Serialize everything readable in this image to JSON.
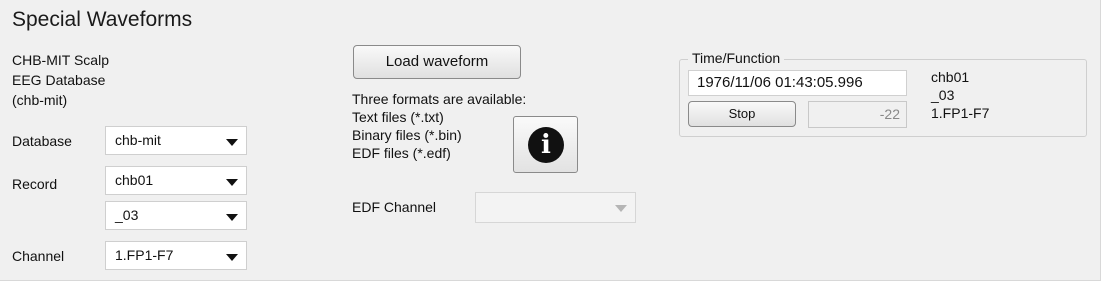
{
  "panel": {
    "title": "Special Waveforms",
    "database_description": [
      "CHB-MIT Scalp",
      "EEG Database",
      "(chb-mit)"
    ]
  },
  "database": {
    "label": "Database",
    "value": "chb-mit"
  },
  "record": {
    "label": "Record",
    "value": "chb01",
    "sub_value": "_03"
  },
  "channel": {
    "label": "Channel",
    "value": "1.FP1-F7"
  },
  "load": {
    "button_label": "Load waveform",
    "formats_heading": "Three formats are available:",
    "formats": [
      "Text files (*.txt)",
      "Binary files (*.bin)",
      "EDF files (*.edf)"
    ],
    "info_icon": "info-icon"
  },
  "edf_channel": {
    "label": "EDF Channel",
    "value": ""
  },
  "time_function": {
    "title": "Time/Function",
    "time_value": "1976/11/06 01:43:05.996",
    "stop_label": "Stop",
    "number_value": "-22",
    "record_info": [
      "chb01",
      "_03",
      "1.FP1-F7"
    ]
  }
}
